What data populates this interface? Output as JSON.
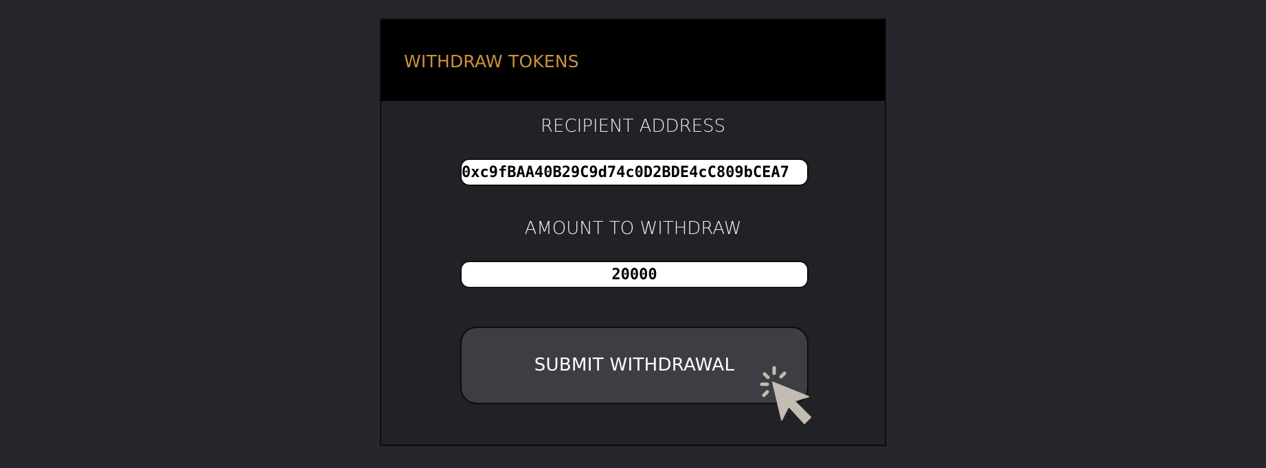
{
  "header": {
    "title": "WITHDRAW TOKENS",
    "title_color": "#cc913c"
  },
  "form": {
    "recipient_label": "RECIPIENT ADDRESS",
    "recipient_value": "0xc9fBAA40B29C9d74c0D2BDE4cC809bCEA7",
    "amount_label": "AMOUNT TO WITHDRAW",
    "amount_value": "20000",
    "submit_label": "SUBMIT WITHDRAWAL"
  },
  "icons": {
    "pointer": "click-cursor-icon"
  },
  "colors": {
    "page_background": "#25272c",
    "card_background": "#202226",
    "header_background": "#000000",
    "button_background": "#3c3e44",
    "cursor": "#c4bcb2"
  }
}
